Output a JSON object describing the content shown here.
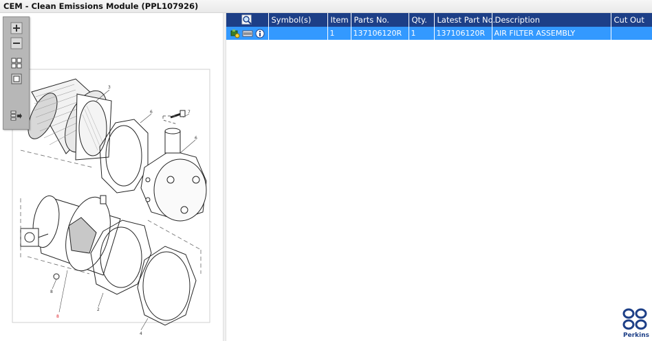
{
  "window": {
    "title": "CEM - Clean Emissions Module (PPL107926)"
  },
  "toolbar": {
    "zoom_in_icon": "zoom-in-icon",
    "zoom_out_icon": "zoom-out-icon",
    "fit_icon": "fit-all-icon",
    "actual_size_icon": "actual-size-icon",
    "export_icon": "export-icon"
  },
  "drawing": {
    "callouts": [
      "3",
      "6",
      "7",
      "6",
      "8",
      "2",
      "4",
      "8"
    ]
  },
  "table": {
    "headers": {
      "icons": "",
      "symbols": "Symbol(s)",
      "item": "Item",
      "parts_no": "Parts No.",
      "qty": "Qty.",
      "latest_part_no": "Latest Part No.",
      "description": "Description",
      "cut_out": "Cut Out"
    },
    "rows": [
      {
        "symbols": "",
        "item": "1",
        "parts_no": "137106120R",
        "qty": "1",
        "latest_part_no": "137106120R",
        "description": "AIR FILTER ASSEMBLY",
        "cut_out": ""
      }
    ],
    "colors": {
      "header_bg": "#1d3f87",
      "selected_row_bg": "#3399ff"
    }
  },
  "brand": {
    "name": "Perkins",
    "color": "#1d3f87"
  }
}
